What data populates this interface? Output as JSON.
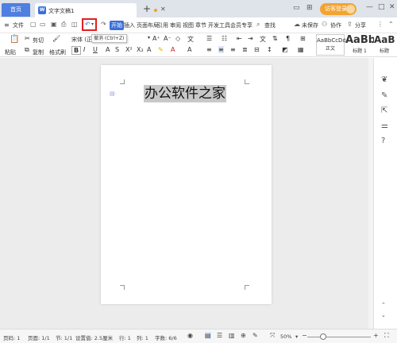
{
  "titlebar": {
    "home_tab": "首页",
    "doc_tab": "文字文稿1",
    "doc_icon": "W",
    "add_tab": "+",
    "login": "访客登录"
  },
  "menubar": {
    "file": "文件",
    "start": "开始",
    "insert": "插入",
    "page_layout": "页面布局",
    "references": "引用",
    "review": "审阅",
    "view": "视图",
    "section": "章节",
    "dev_tools": "开发工具",
    "member": "会员专享",
    "search": "查找",
    "unsaved": "未保存",
    "collab": "协作",
    "share": "分享"
  },
  "tooltip": "撤消 (Ctrl+Z)",
  "ribbon": {
    "cut": "剪切",
    "paste": "粘贴",
    "copy": "复制",
    "format_painter": "格式刷",
    "font_name": "宋体 (正",
    "styles": [
      {
        "sample": "AaBbCcDd",
        "label": "正文"
      },
      {
        "sample": "AaBb",
        "label": "标题 1"
      },
      {
        "sample": "AaB",
        "label": "标题"
      }
    ]
  },
  "document": {
    "heading": "办公软件之家"
  },
  "statusbar": {
    "page_num": "页码: 1",
    "pages": "页面: 1/1",
    "section": "节: 1/1",
    "setting": "设置值: 2.5厘米",
    "row": "行: 1",
    "col": "列: 1",
    "word_count": "字数: 6/6",
    "zoom": "50%"
  },
  "colors": {
    "accent": "#3b6fd9",
    "login": "#f3a332",
    "undo_highlight": "#e02020"
  }
}
